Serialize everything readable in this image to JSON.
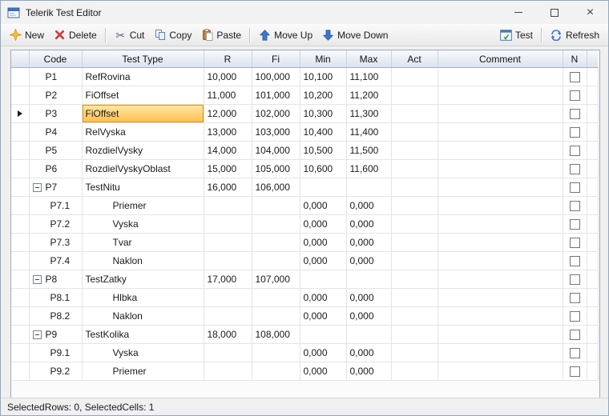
{
  "window": {
    "title": "Telerik Test Editor"
  },
  "icons": {
    "app": "window-icon",
    "minimize": "horizontal-line",
    "maximize": "square-outline",
    "close": "x-mark",
    "new": "orange-sparkle-star",
    "delete": "red-x",
    "cut": "scissors",
    "copy": "two-pages",
    "paste": "clipboard-with-page",
    "move_up": "blue-arrow-up",
    "move_down": "blue-arrow-down",
    "test": "window-with-green-check",
    "refresh": "blue-circular-arrows",
    "collapse": "minus-box",
    "current_row": "black-right-triangle"
  },
  "toolbar": {
    "items": [
      {
        "label": "New"
      },
      {
        "label": "Delete"
      },
      {
        "label": "Cut"
      },
      {
        "label": "Copy"
      },
      {
        "label": "Paste"
      },
      {
        "label": "Move Up"
      },
      {
        "label": "Move Down"
      }
    ],
    "right_items": [
      {
        "label": "Test"
      },
      {
        "label": "Refresh"
      }
    ]
  },
  "grid": {
    "columns": [
      "",
      "Code",
      "Test Type",
      "R",
      "Fi",
      "Min",
      "Max",
      "Act",
      "Comment",
      "N"
    ],
    "rows": [
      {
        "code": "P1",
        "type": "RefRovina",
        "r": "10,000",
        "fi": "100,000",
        "min": "10,100",
        "max": "11,100",
        "act": "",
        "comment": ""
      },
      {
        "code": "P2",
        "type": "FiOffset",
        "r": "11,000",
        "fi": "101,000",
        "min": "10,200",
        "max": "11,200",
        "act": "",
        "comment": ""
      },
      {
        "code": "P3",
        "type": "FiOffset",
        "r": "12,000",
        "fi": "102,000",
        "min": "10,300",
        "max": "11,300",
        "act": "",
        "comment": "",
        "current": true,
        "selected": true
      },
      {
        "code": "P4",
        "type": "RelVyska",
        "r": "13,000",
        "fi": "103,000",
        "min": "10,400",
        "max": "11,400",
        "act": "",
        "comment": ""
      },
      {
        "code": "P5",
        "type": "RozdielVysky",
        "r": "14,000",
        "fi": "104,000",
        "min": "10,500",
        "max": "11,500",
        "act": "",
        "comment": ""
      },
      {
        "code": "P6",
        "type": "RozdielVyskyOblast",
        "r": "15,000",
        "fi": "105,000",
        "min": "10,600",
        "max": "11,600",
        "act": "",
        "comment": ""
      },
      {
        "code": "P7",
        "type": "TestNitu",
        "r": "16,000",
        "fi": "106,000",
        "min": "",
        "max": "",
        "act": "",
        "comment": "",
        "expander": true
      },
      {
        "code": "P7.1",
        "type": "Priemer",
        "r": "",
        "fi": "",
        "min": "0,000",
        "max": "0,000",
        "act": "",
        "comment": "",
        "child": true
      },
      {
        "code": "P7.2",
        "type": "Vyska",
        "r": "",
        "fi": "",
        "min": "0,000",
        "max": "0,000",
        "act": "",
        "comment": "",
        "child": true
      },
      {
        "code": "P7.3",
        "type": "Tvar",
        "r": "",
        "fi": "",
        "min": "0,000",
        "max": "0,000",
        "act": "",
        "comment": "",
        "child": true
      },
      {
        "code": "P7.4",
        "type": "Naklon",
        "r": "",
        "fi": "",
        "min": "0,000",
        "max": "0,000",
        "act": "",
        "comment": "",
        "child": true
      },
      {
        "code": "P8",
        "type": "TestZatky",
        "r": "17,000",
        "fi": "107,000",
        "min": "",
        "max": "",
        "act": "",
        "comment": "",
        "expander": true
      },
      {
        "code": "P8.1",
        "type": "Hlbka",
        "r": "",
        "fi": "",
        "min": "0,000",
        "max": "0,000",
        "act": "",
        "comment": "",
        "child": true
      },
      {
        "code": "P8.2",
        "type": "Naklon",
        "r": "",
        "fi": "",
        "min": "0,000",
        "max": "0,000",
        "act": "",
        "comment": "",
        "child": true
      },
      {
        "code": "P9",
        "type": "TestKolika",
        "r": "18,000",
        "fi": "108,000",
        "min": "",
        "max": "",
        "act": "",
        "comment": "",
        "expander": true
      },
      {
        "code": "P9.1",
        "type": "Vyska",
        "r": "",
        "fi": "",
        "min": "0,000",
        "max": "0,000",
        "act": "",
        "comment": "",
        "child": true
      },
      {
        "code": "P9.2",
        "type": "Priemer",
        "r": "",
        "fi": "",
        "min": "0,000",
        "max": "0,000",
        "act": "",
        "comment": "",
        "child": true
      }
    ]
  },
  "status": {
    "text": "SelectedRows: 0, SelectedCells: 1"
  }
}
